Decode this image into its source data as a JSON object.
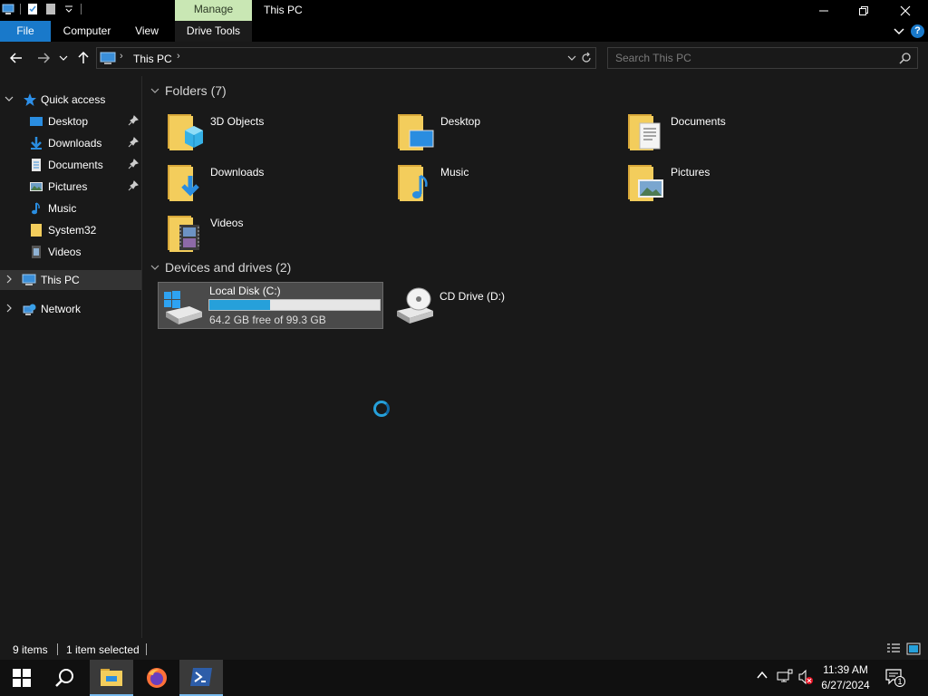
{
  "window": {
    "title": "This PC",
    "contextual_tab": "Manage",
    "controls": {
      "minimize": "—",
      "maximize": "❐",
      "close": "✕"
    }
  },
  "ribbon": {
    "tabs": [
      {
        "label": "File"
      },
      {
        "label": "Computer"
      },
      {
        "label": "View"
      },
      {
        "label": "Drive Tools"
      }
    ],
    "help": "?",
    "file_color": "#1979ca"
  },
  "address": {
    "crumbs": [
      "This PC"
    ],
    "search_placeholder": "Search This PC"
  },
  "navpane": {
    "quick_access": "Quick access",
    "quick_items": [
      {
        "label": "Desktop",
        "icon": "desktop-icon",
        "pinned": true
      },
      {
        "label": "Downloads",
        "icon": "downloads-icon",
        "pinned": true
      },
      {
        "label": "Documents",
        "icon": "documents-icon",
        "pinned": true
      },
      {
        "label": "Pictures",
        "icon": "pictures-icon",
        "pinned": true
      },
      {
        "label": "Music",
        "icon": "music-icon",
        "pinned": false
      },
      {
        "label": "System32",
        "icon": "folder-icon",
        "pinned": false
      },
      {
        "label": "Videos",
        "icon": "videos-icon",
        "pinned": false
      }
    ],
    "this_pc": "This PC",
    "network": "Network"
  },
  "content": {
    "folders_header": "Folders (7)",
    "folders": [
      {
        "label": "3D Objects",
        "icon": "3d-objects-icon"
      },
      {
        "label": "Desktop",
        "icon": "desktop-folder-icon"
      },
      {
        "label": "Documents",
        "icon": "documents-folder-icon"
      },
      {
        "label": "Downloads",
        "icon": "downloads-folder-icon"
      },
      {
        "label": "Music",
        "icon": "music-folder-icon"
      },
      {
        "label": "Pictures",
        "icon": "pictures-folder-icon"
      },
      {
        "label": "Videos",
        "icon": "videos-folder-icon"
      }
    ],
    "devices_header": "Devices and drives (2)",
    "drives": [
      {
        "label": "Local Disk (C:)",
        "free_text": "64.2 GB free of 99.3 GB",
        "used_fraction": 0.354
      },
      {
        "label": "CD Drive (D:)"
      }
    ]
  },
  "status": {
    "items": "9 items",
    "selected": "1 item selected"
  },
  "taskbar": {
    "time": "11:39 AM",
    "date": "6/27/2024",
    "notification_count": "1",
    "accent": "#76b9ed"
  }
}
